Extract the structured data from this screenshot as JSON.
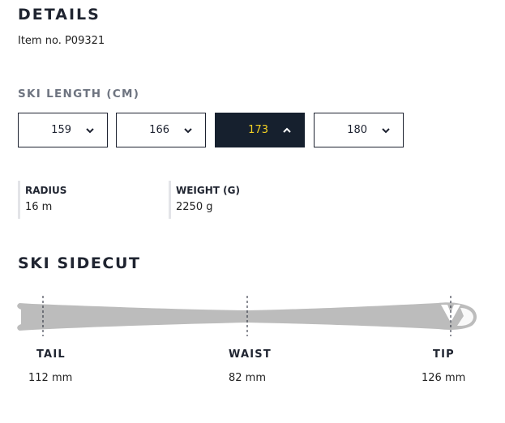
{
  "details": {
    "title": "DETAILS",
    "item_no": "Item no. P09321"
  },
  "ski_length": {
    "title": "SKI LENGTH (CM)",
    "options": [
      {
        "label": "159",
        "icon": "chevron-down-icon",
        "selected": false
      },
      {
        "label": "166",
        "icon": "chevron-down-icon",
        "selected": false
      },
      {
        "label": "173",
        "icon": "chevron-up-icon",
        "selected": true
      },
      {
        "label": "180",
        "icon": "chevron-down-icon",
        "selected": false
      }
    ]
  },
  "specs": [
    {
      "label": "RADIUS",
      "value": "16 m"
    },
    {
      "label": "WEIGHT (G)",
      "value": "2250 g"
    }
  ],
  "sidecut": {
    "title": "SKI SIDECUT",
    "points": [
      {
        "label": "TAIL",
        "value": "112 mm"
      },
      {
        "label": "WAIST",
        "value": "82 mm"
      },
      {
        "label": "TIP",
        "value": "126 mm"
      }
    ]
  },
  "colors": {
    "selected_bg": "#16202e",
    "selected_text": "#f2d024",
    "ski_fill": "#bcbcbc"
  }
}
